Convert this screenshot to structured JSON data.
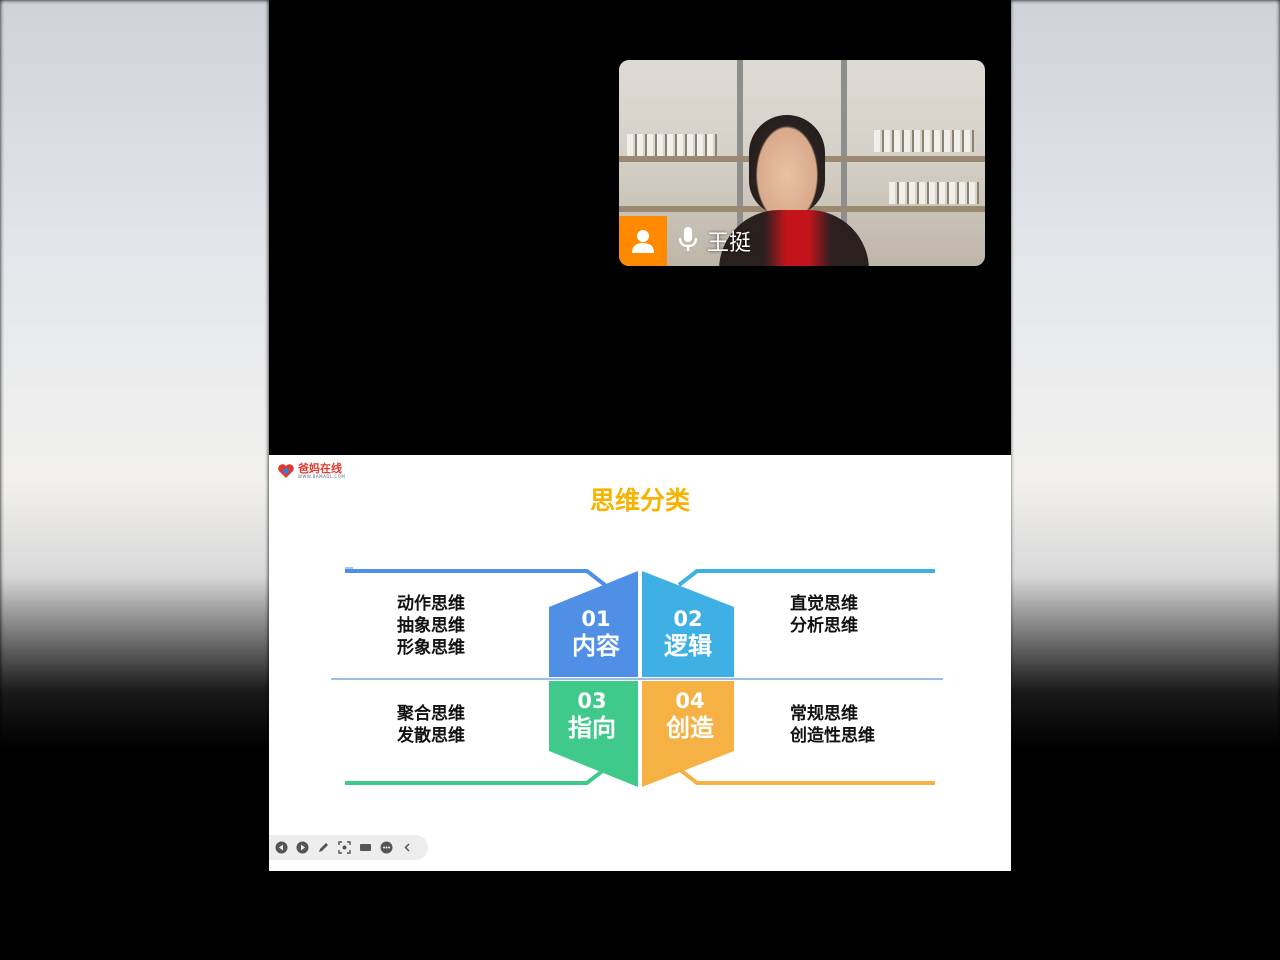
{
  "camera": {
    "participant_name": "王挺",
    "mic_icon": "microphone-icon",
    "avatar_icon": "person-icon",
    "badge_color": "#ff8a00"
  },
  "slide": {
    "logo_text": "爸妈在线",
    "logo_subtext": "WWW.BAMADL.COM",
    "title": "思维分类",
    "title_color": "#f6b400",
    "quadrants": [
      {
        "number": "01",
        "label": "内容",
        "color": "#4f8fe6",
        "items": [
          "动作思维",
          "抽象思维",
          "形象思维"
        ]
      },
      {
        "number": "02",
        "label": "逻辑",
        "color": "#3fb0e3",
        "items": [
          "直觉思维",
          "分析思维"
        ]
      },
      {
        "number": "03",
        "label": "指向",
        "color": "#3fca8b",
        "items": [
          "聚合思维",
          "发散思维"
        ]
      },
      {
        "number": "04",
        "label": "创造",
        "color": "#f6b144",
        "items": [
          "常规思维",
          "创造性思维"
        ]
      }
    ]
  },
  "toolbar": {
    "buttons": [
      "prev-icon",
      "next-icon",
      "pen-icon",
      "screenshot-icon",
      "screen-icon",
      "more-icon",
      "collapse-icon"
    ]
  }
}
